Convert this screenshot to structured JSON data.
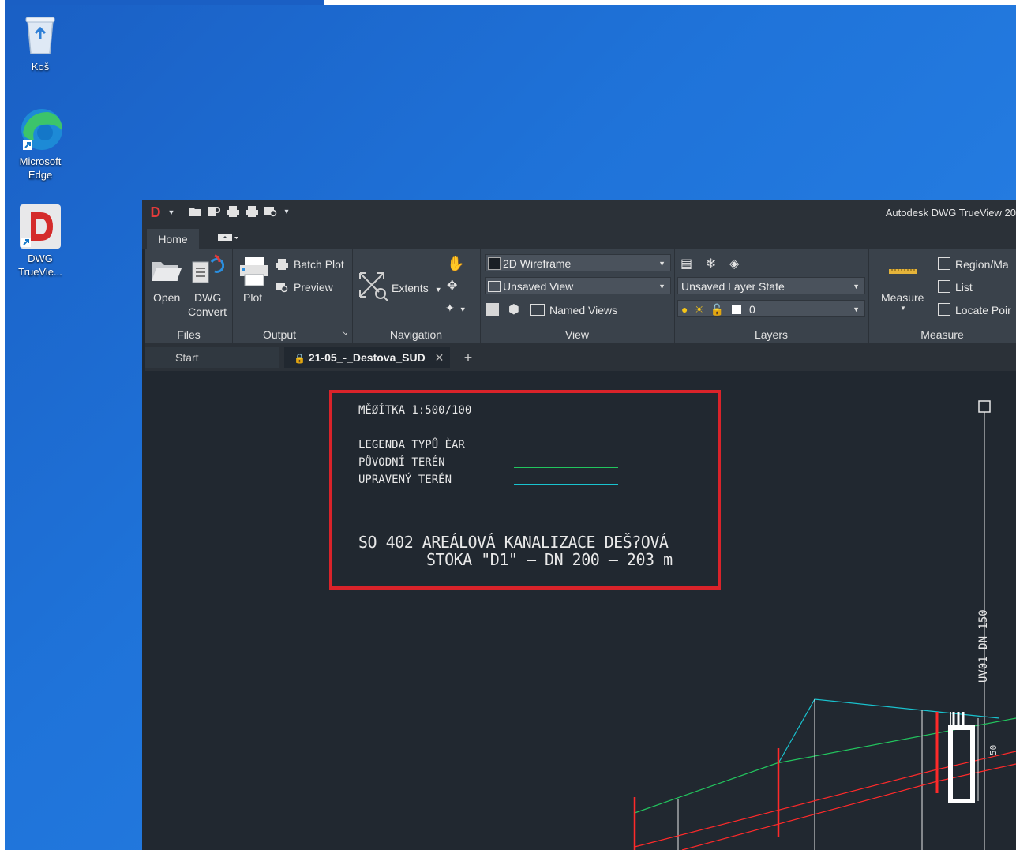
{
  "desktop": {
    "icons": [
      {
        "label": "Koš"
      },
      {
        "label": "Microsoft Edge"
      },
      {
        "label": "DWG TrueVie..."
      }
    ]
  },
  "app": {
    "title": "Autodesk DWG TrueView 20",
    "ribbon_tabs": [
      "Home"
    ],
    "files": {
      "open": "Open",
      "dwg_convert_1": "DWG",
      "dwg_convert_2": "Convert",
      "title": "Files"
    },
    "output": {
      "plot": "Plot",
      "batch_plot": "Batch Plot",
      "preview": "Preview",
      "title": "Output"
    },
    "navigation": {
      "extents": "Extents",
      "title": "Navigation"
    },
    "view": {
      "visual_style": "2D Wireframe",
      "saved_view": "Unsaved View",
      "named_views": "Named Views",
      "title": "View"
    },
    "layers": {
      "layer_state": "Unsaved Layer State",
      "current_layer": "0",
      "title": "Layers"
    },
    "measure": {
      "measure": "Measure",
      "region": "Region/Ma",
      "list": "List",
      "locate_point": "Locate Poir",
      "title": "Measure"
    },
    "doc_tabs": {
      "start": "Start",
      "active": "21-05_-_Destova_SUD",
      "close": "✕",
      "add": "+"
    }
  },
  "drawing": {
    "scale": "MĚØÍTKA 1:500/100",
    "legend_title": "LEGENDA TYPŮ ÈAR",
    "legend_items": [
      {
        "label": "PŮVODNÍ TERÉN",
        "color": "#22c55e"
      },
      {
        "label": "UPRAVENÝ TERÉN",
        "color": "#19c3cf"
      }
    ],
    "title_line1": "SO 402 AREÁLOVÁ KANALIZACE DEŠ?OVÁ",
    "title_line2": "STOKA \"D1\" – DN 200 – 203 m",
    "vertical_label": "UV01 DN 150",
    "small_label": "50",
    "highlight_color": "#d9232a"
  }
}
